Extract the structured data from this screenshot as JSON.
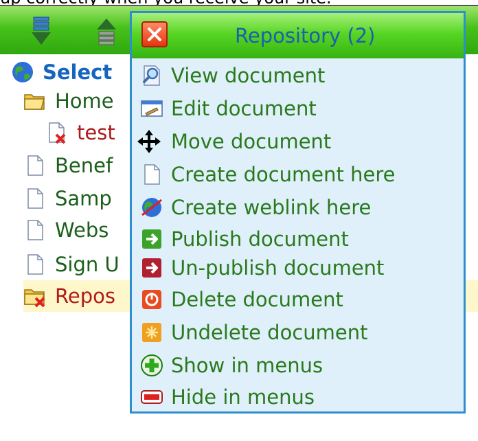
{
  "top_note": "up correctly when you receive your site.",
  "tree": {
    "items": [
      {
        "label": "Select",
        "icon": "globe-icon",
        "color": "#1565c0",
        "bold": true
      },
      {
        "label": "Home",
        "icon": "folder-open-icon",
        "color": "#1b5f1b"
      },
      {
        "label": "test",
        "icon": "document-deleted-icon",
        "color": "#b01a1a"
      },
      {
        "label": "Benef",
        "icon": "document-icon",
        "color": "#1b5f1b"
      },
      {
        "label": "Samp",
        "icon": "document-icon",
        "color": "#1b5f1b"
      },
      {
        "label": "Webs",
        "icon": "document-icon",
        "color": "#1b5f1b"
      },
      {
        "label": "Sign U",
        "icon": "document-icon",
        "color": "#1b5f1b"
      },
      {
        "label": "Repos",
        "icon": "folder-deleted-icon",
        "color": "#b01a1a"
      }
    ]
  },
  "menu": {
    "title": "Repository (2)",
    "items": [
      {
        "label": "View document",
        "icon": "magnifier-icon"
      },
      {
        "label": "Edit document",
        "icon": "edit-icon"
      },
      {
        "label": "Move document",
        "icon": "move-arrows-icon"
      },
      {
        "label": "Create document here",
        "icon": "document-icon"
      },
      {
        "label": "Create weblink here",
        "icon": "weblink-globe-icon"
      },
      {
        "label": "Publish document",
        "icon": "publish-arrow-icon"
      },
      {
        "label": "Un-publish document",
        "icon": "unpublish-arrow-icon"
      },
      {
        "label": "Delete document",
        "icon": "delete-power-icon"
      },
      {
        "label": "Undelete document",
        "icon": "undelete-sparkle-icon"
      },
      {
        "label": "Show in menus",
        "icon": "plus-icon"
      },
      {
        "label": "Hide in menus",
        "icon": "minus-icon"
      }
    ]
  },
  "colors": {
    "menu_text": "#2a7a1c",
    "menu_title": "#1b5fb0",
    "menu_border": "#2d8fd0",
    "toolbar": "#46c21a"
  }
}
